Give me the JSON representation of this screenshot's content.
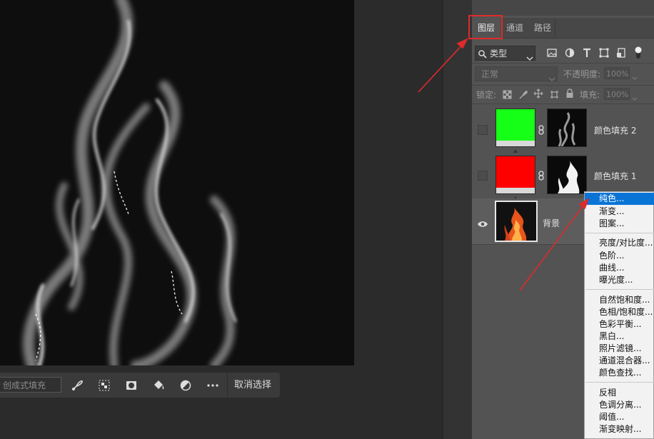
{
  "canvas": {
    "description_icon": "smoke-flame-image"
  },
  "taskbar": {
    "fill_placeholder": "创成式填充",
    "deselect_label": "取消选择"
  },
  "panel": {
    "tabs": [
      {
        "label": "图层"
      },
      {
        "label": "通道"
      },
      {
        "label": "路径"
      }
    ],
    "filter": {
      "value": "类型"
    },
    "blend_mode": "正常",
    "opacity_label": "不透明度:",
    "opacity_value": "100%",
    "lock_label": "锁定:",
    "fill_label": "填充:",
    "fill_value": "100%",
    "layers": [
      {
        "name": "颜色填充 2",
        "color": "#16ff16"
      },
      {
        "name": "颜色填充 1",
        "color": "#ff0000"
      },
      {
        "name": "背景"
      }
    ]
  },
  "menu": {
    "groups": [
      [
        "纯色...",
        "渐变...",
        "图案..."
      ],
      [
        "亮度/对比度...",
        "色阶...",
        "曲线...",
        "曝光度..."
      ],
      [
        "自然饱和度...",
        "色相/饱和度...",
        "色彩平衡...",
        "黑白...",
        "照片滤镜...",
        "通道混合器...",
        "颜色查找..."
      ],
      [
        "反相",
        "色调分离...",
        "阈值...",
        "渐变映射..."
      ]
    ],
    "selected": "纯色..."
  },
  "colors": {
    "accent": "#0a74d6",
    "annotation": "#e02a2a"
  }
}
